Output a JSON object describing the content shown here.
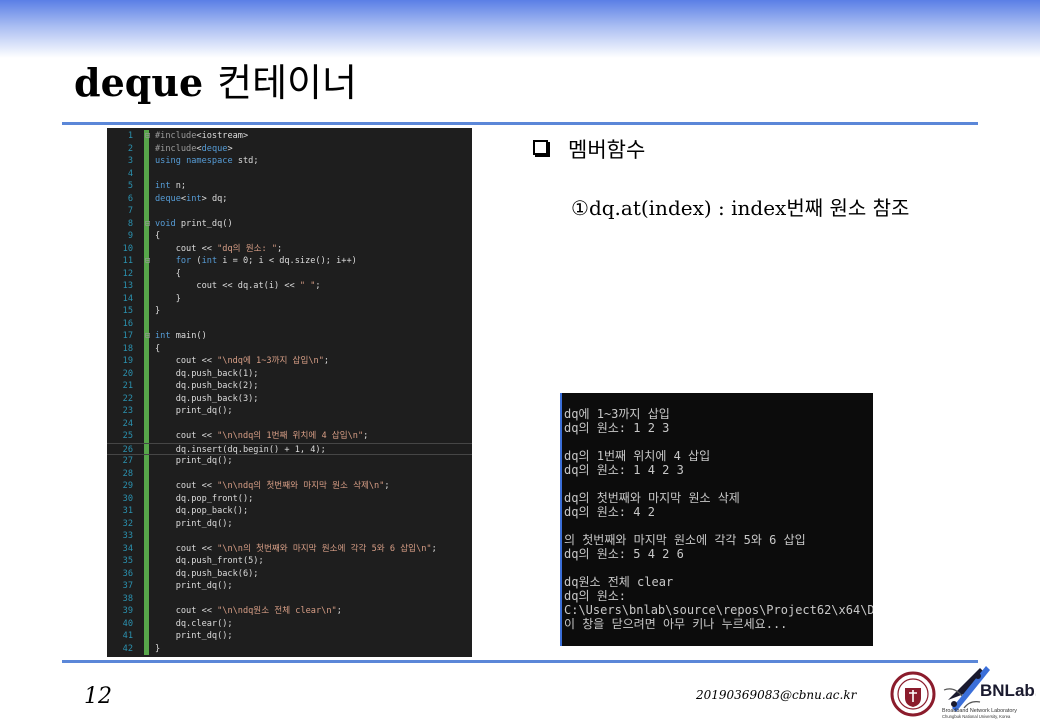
{
  "header": {
    "title_en": "deque",
    "title_ko": "컨테이너"
  },
  "code_lines": [
    {
      "n": "1",
      "f": "⊟",
      "t": "#include<iostream>"
    },
    {
      "n": "2",
      "f": "",
      "t": "#include<deque>"
    },
    {
      "n": "3",
      "f": "",
      "t": "using namespace std;"
    },
    {
      "n": "4",
      "f": "",
      "t": ""
    },
    {
      "n": "5",
      "f": "",
      "t": "int n;"
    },
    {
      "n": "6",
      "f": "",
      "t": "deque<int> dq;"
    },
    {
      "n": "7",
      "f": "",
      "t": ""
    },
    {
      "n": "8",
      "f": "⊟",
      "t": "void print_dq()"
    },
    {
      "n": "9",
      "f": "",
      "t": "{"
    },
    {
      "n": "10",
      "f": "",
      "t": "    cout << \"dq의 원소: \";"
    },
    {
      "n": "11",
      "f": "⊟",
      "t": "    for (int i = 0; i < dq.size(); i++)"
    },
    {
      "n": "12",
      "f": "",
      "t": "    {"
    },
    {
      "n": "13",
      "f": "",
      "t": "        cout << dq.at(i) << \" \";"
    },
    {
      "n": "14",
      "f": "",
      "t": "    }"
    },
    {
      "n": "15",
      "f": "",
      "t": "}"
    },
    {
      "n": "16",
      "f": "",
      "t": ""
    },
    {
      "n": "17",
      "f": "⊟",
      "t": "int main()"
    },
    {
      "n": "18",
      "f": "",
      "t": "{"
    },
    {
      "n": "19",
      "f": "",
      "t": "    cout << \"\\ndq에 1~3까지 삽입\\n\";"
    },
    {
      "n": "20",
      "f": "",
      "t": "    dq.push_back(1);"
    },
    {
      "n": "21",
      "f": "",
      "t": "    dq.push_back(2);"
    },
    {
      "n": "22",
      "f": "",
      "t": "    dq.push_back(3);"
    },
    {
      "n": "23",
      "f": "",
      "t": "    print_dq();"
    },
    {
      "n": "24",
      "f": "",
      "t": ""
    },
    {
      "n": "25",
      "f": "",
      "t": "    cout << \"\\n\\ndq의 1번째 위치에 4 삽입\\n\";"
    },
    {
      "n": "26",
      "f": "",
      "t": "    dq.insert(dq.begin() + 1, 4);"
    },
    {
      "n": "27",
      "f": "",
      "t": "    print_dq();"
    },
    {
      "n": "28",
      "f": "",
      "t": ""
    },
    {
      "n": "29",
      "f": "",
      "t": "    cout << \"\\n\\ndq의 첫번째와 마지막 원소 삭제\\n\";"
    },
    {
      "n": "30",
      "f": "",
      "t": "    dq.pop_front();"
    },
    {
      "n": "31",
      "f": "",
      "t": "    dq.pop_back();"
    },
    {
      "n": "32",
      "f": "",
      "t": "    print_dq();"
    },
    {
      "n": "33",
      "f": "",
      "t": ""
    },
    {
      "n": "34",
      "f": "",
      "t": "    cout << \"\\n\\n의 첫번째와 마지막 원소에 각각 5와 6 삽입\\n\";"
    },
    {
      "n": "35",
      "f": "",
      "t": "    dq.push_front(5);"
    },
    {
      "n": "36",
      "f": "",
      "t": "    dq.push_back(6);"
    },
    {
      "n": "37",
      "f": "",
      "t": "    print_dq();"
    },
    {
      "n": "38",
      "f": "",
      "t": ""
    },
    {
      "n": "39",
      "f": "",
      "t": "    cout << \"\\n\\ndq원소 전체 clear\\n\";"
    },
    {
      "n": "40",
      "f": "",
      "t": "    dq.clear();"
    },
    {
      "n": "41",
      "f": "",
      "t": "    print_dq();"
    },
    {
      "n": "42",
      "f": "",
      "t": "}"
    }
  ],
  "right": {
    "bullet": "멤버함수",
    "sub_marker": "①",
    "sub_text_en": "dq.at(index) : index",
    "sub_text_ko": "번째 원소 참조"
  },
  "console_lines": [
    "dq에 1~3까지 삽입",
    "dq의 원소: 1 2 3",
    "",
    "dq의 1번째 위치에 4 삽입",
    "dq의 원소: 1 4 2 3",
    "",
    "dq의 첫번째와 마지막 원소 삭제",
    "dq의 원소: 4 2",
    "",
    "의 첫번째와 마지막 원소에 각각 5와 6 삽입",
    "dq의 원소: 5 4 2 6",
    "",
    "dq원소 전체 clear",
    "dq의 원소:",
    "C:\\Users\\bnlab\\source\\repos\\Project62\\x64\\De",
    "이 창을 닫으려면 아무 키나 누르세요..."
  ],
  "footer": {
    "page": "12",
    "email": "20190369083@cbnu.ac.kr",
    "logo_text": "BNLab.",
    "logo_sub1": "Broadband Network Laboratory",
    "logo_sub2": "Chungbuk National University, Korea"
  },
  "colors": {
    "rule": "#5b87d8",
    "code_bg": "#1e1e1e",
    "console_bg": "#0c0c0c",
    "keyword": "#569cd6",
    "string": "#d69d85",
    "linenum": "#2b91af"
  }
}
